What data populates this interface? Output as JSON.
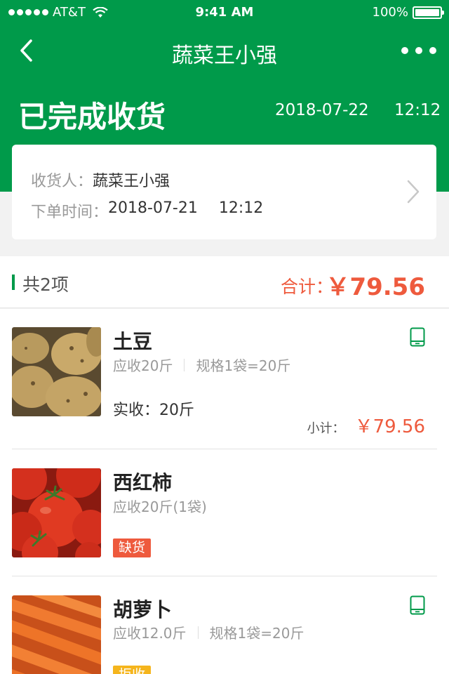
{
  "status_bar": {
    "carrier": "AT&T",
    "time": "9:41 AM",
    "battery": "100%"
  },
  "nav": {
    "title": "蔬菜王小强"
  },
  "order": {
    "status": "已完成收货",
    "date": "2018-07-22",
    "time": "12:12"
  },
  "receiver": {
    "label_receiver": "收货人：",
    "receiver_name": "蔬菜王小强",
    "label_order_time": "下单时间：",
    "order_date": "2018-07-21",
    "order_time": "12:12"
  },
  "summary": {
    "count": "共2项",
    "total_label": "合计：",
    "total_value": "￥79.56"
  },
  "items": [
    {
      "name": "土豆",
      "expected": "应收20斤",
      "spec": "规格1袋=20斤",
      "actual": "实收：20斤",
      "subtotal_label": "小计：",
      "subtotal_value": "￥79.56",
      "icon": "phone-icon"
    },
    {
      "name": "西红柿",
      "expected": "应收20斤(1袋)",
      "tag": "缺货"
    },
    {
      "name": "胡萝卜",
      "expected": "应收12.0斤",
      "spec": "规格1袋=20斤",
      "tag": "拒收",
      "icon": "phone-icon"
    }
  ],
  "colors": {
    "brand": "#009a4a",
    "price": "#ee5a3d",
    "tag_shortage": "#ee5a3d",
    "tag_rejected": "#f5b51d"
  }
}
